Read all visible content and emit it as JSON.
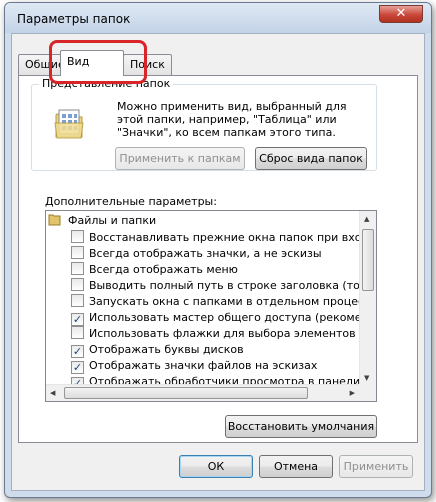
{
  "window": {
    "title": "Параметры папок",
    "close_glyph": "✕"
  },
  "tabs": [
    {
      "label": "Общие"
    },
    {
      "label": "Вид"
    },
    {
      "label": "Поиск"
    }
  ],
  "folder_view": {
    "group_label": "Представление папок",
    "description": "Можно применить вид, выбранный для этой папки, например, \"Таблица\" или \"Значки\", ко всем папкам этого типа.",
    "apply_button": "Применить к папкам",
    "reset_button": "Сброс вида папок"
  },
  "advanced": {
    "label": "Дополнительные параметры:",
    "root": "Файлы и папки",
    "items": [
      {
        "label": "Восстанавливать прежние окна папок при входе в си",
        "checked": false
      },
      {
        "label": "Всегда отображать значки, а не эскизы",
        "checked": false
      },
      {
        "label": "Всегда отображать меню",
        "checked": false
      },
      {
        "label": "Выводить полный путь в строке заголовка (только д",
        "checked": false
      },
      {
        "label": "Запускать окна с папками в отдельном процессе",
        "checked": false
      },
      {
        "label": "Использовать мастер общего доступа (рекомендует",
        "checked": true
      },
      {
        "label": "Использовать флажки для выбора элементов",
        "checked": false
      },
      {
        "label": "Отображать буквы дисков",
        "checked": true
      },
      {
        "label": "Отображать значки файлов на эскизах",
        "checked": true
      },
      {
        "label": "Отображать обработчики просмотра в панели просм",
        "checked": true
      }
    ]
  },
  "restore_button": "Восстановить умолчания",
  "footer": {
    "ok": "ОК",
    "cancel": "Отмена",
    "apply": "Применить"
  },
  "colors": {
    "highlight": "#d8252a",
    "title_bg": "#cfdceb"
  }
}
